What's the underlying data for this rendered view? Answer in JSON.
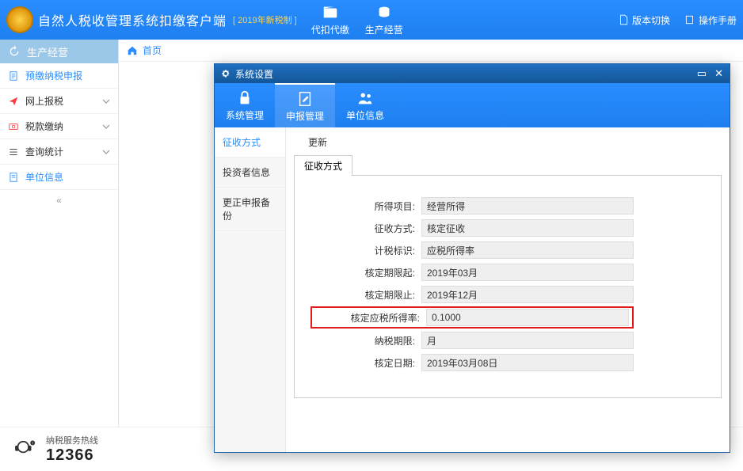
{
  "header": {
    "app_title": "自然人税收管理系统扣缴客户端",
    "new_tax_tag": "[ 2019年新税制 ]",
    "nav": [
      {
        "label": "代扣代缴"
      },
      {
        "label": "生产经营"
      }
    ],
    "right_links": [
      {
        "label": "版本切换"
      },
      {
        "label": "操作手册"
      }
    ]
  },
  "sidebar": {
    "section_title": "生产经营",
    "items": [
      {
        "label": "预缴纳税申报",
        "color": "#2a8dff"
      },
      {
        "label": "网上报税",
        "color": "#ff3b3b",
        "expandable": true
      },
      {
        "label": "税款缴纳",
        "color": "#ff3b3b",
        "expandable": true
      },
      {
        "label": "查询统计",
        "color": "#333",
        "expandable": true
      },
      {
        "label": "单位信息",
        "color": "#2a8dff"
      }
    ]
  },
  "breadcrumb": {
    "home": "首页"
  },
  "dialog": {
    "title": "系统设置",
    "tabs": [
      {
        "label": "系统管理"
      },
      {
        "label": "申报管理"
      },
      {
        "label": "单位信息"
      }
    ],
    "inner_sidebar": [
      {
        "label": "征收方式"
      },
      {
        "label": "投资者信息"
      },
      {
        "label": "更正申报备份"
      }
    ],
    "update_label": "更新",
    "inner_tab": "征收方式",
    "form": [
      {
        "label": "所得项目:",
        "value": "经营所得"
      },
      {
        "label": "征收方式:",
        "value": "核定征收"
      },
      {
        "label": "计税标识:",
        "value": "应税所得率"
      },
      {
        "label": "核定期限起:",
        "value": "2019年03月"
      },
      {
        "label": "核定期限止:",
        "value": "2019年12月"
      },
      {
        "label": "核定应税所得率:",
        "value": "0.1000",
        "highlight": true
      },
      {
        "label": "纳税期限:",
        "value": "月"
      },
      {
        "label": "核定日期:",
        "value": "2019年03月08日"
      }
    ]
  },
  "footer": {
    "hotline_label": "纳税服务热线",
    "hotline_number": "12366"
  }
}
